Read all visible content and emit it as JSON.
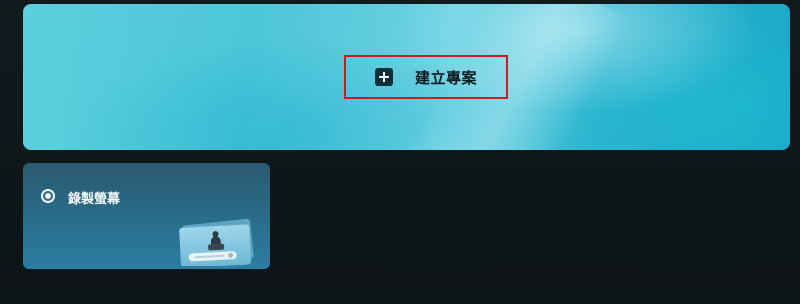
{
  "hero": {
    "create_button_label": "建立專案",
    "create_button_icon": "plus-icon"
  },
  "card": {
    "label": "錄製螢幕",
    "radio_icon": "radio-selected-icon",
    "thumbnail_icon": "screen-recording-thumbnail-icon"
  },
  "colors": {
    "background": "#0f1619",
    "hero_accent": "#4cc6d8",
    "highlight_border": "#d31a1a"
  }
}
